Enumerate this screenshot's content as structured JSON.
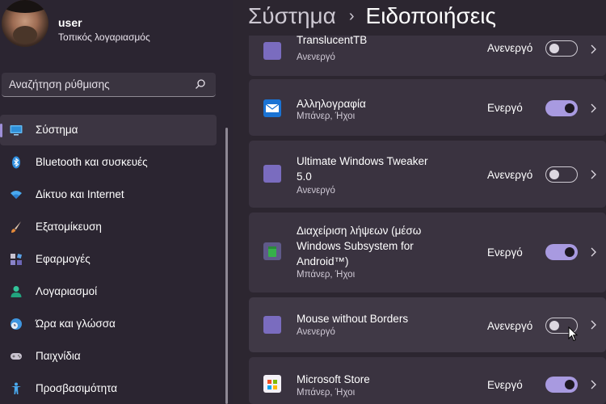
{
  "profile": {
    "name": "user",
    "subtitle": "Τοπικός λογαριασμός"
  },
  "search": {
    "placeholder": "Αναζήτηση ρύθμισης",
    "icon": "search-icon"
  },
  "nav": {
    "items": [
      {
        "label": "Σύστημα",
        "icon": "monitor-icon",
        "active": true
      },
      {
        "label": "Bluetooth και συσκευές",
        "icon": "bluetooth-icon"
      },
      {
        "label": "Δίκτυο και Internet",
        "icon": "wifi-icon"
      },
      {
        "label": "Εξατομίκευση",
        "icon": "paintbrush-icon"
      },
      {
        "label": "Εφαρμογές",
        "icon": "apps-icon"
      },
      {
        "label": "Λογαριασμοί",
        "icon": "person-icon"
      },
      {
        "label": "Ώρα και γλώσσα",
        "icon": "globe-clock-icon"
      },
      {
        "label": "Παιχνίδια",
        "icon": "gamepad-icon"
      },
      {
        "label": "Προσβασιμότητα",
        "icon": "accessibility-icon"
      }
    ]
  },
  "breadcrumb": {
    "parent": "Σύστημα",
    "separator": "›",
    "current": "Ειδοποιήσεις"
  },
  "apps": [
    {
      "name": "TranslucentTB",
      "sub": "Ανενεργό",
      "state": "Ανενεργό",
      "on": false,
      "icon": "app-tile-icon"
    },
    {
      "name": "Αλληλογραφία",
      "sub": "Μπάνερ, Ήχοι",
      "state": "Ενεργό",
      "on": true,
      "icon": "mail-icon"
    },
    {
      "name": "Ultimate Windows Tweaker 5.0",
      "sub": "Ανενεργό",
      "state": "Ανενεργό",
      "on": false,
      "icon": "app-tile-icon"
    },
    {
      "name": "Διαχείριση λήψεων (μέσω Windows Subsystem for Android™)",
      "sub": "Μπάνερ, Ήχοι",
      "state": "Ενεργό",
      "on": true,
      "icon": "download-manager-icon"
    },
    {
      "name": "Mouse without Borders",
      "sub": "Ανενεργό",
      "state": "Ανενεργό",
      "on": false,
      "icon": "app-tile-icon"
    },
    {
      "name": "Microsoft Store",
      "sub": "Μπάνερ, Ήχοι",
      "state": "Ενεργό",
      "on": true,
      "icon": "store-icon"
    }
  ],
  "colors": {
    "accent": "#a89ae0",
    "background": "#2c2630",
    "card": "#3a3340"
  }
}
